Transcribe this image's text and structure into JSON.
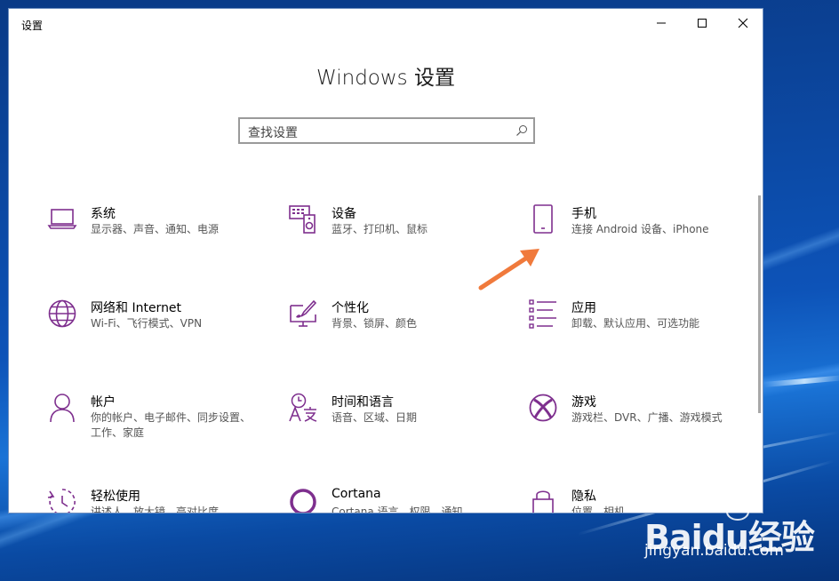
{
  "window": {
    "title": "设置",
    "controls": {
      "minimize": "minimize-icon",
      "maximize": "maximize-icon",
      "close": "close-icon"
    }
  },
  "page": {
    "title": "Windows 设置"
  },
  "search": {
    "placeholder": "查找设置",
    "icon": "search-icon"
  },
  "accent": "#7e2f8e",
  "tiles": [
    {
      "name": "系统",
      "desc": "显示器、声音、通知、电源",
      "icon": "laptop-icon"
    },
    {
      "name": "设备",
      "desc": "蓝牙、打印机、鼠标",
      "icon": "keyboard-speaker-icon"
    },
    {
      "name": "手机",
      "desc": "连接 Android 设备、iPhone",
      "icon": "phone-icon"
    },
    {
      "name": "网络和 Internet",
      "desc": "Wi-Fi、飞行模式、VPN",
      "icon": "globe-icon"
    },
    {
      "name": "个性化",
      "desc": "背景、锁屏、颜色",
      "icon": "paint-monitor-icon"
    },
    {
      "name": "应用",
      "desc": "卸载、默认应用、可选功能",
      "icon": "app-list-icon"
    },
    {
      "name": "帐户",
      "desc": "你的帐户、电子邮件、同步设置、工作、家庭",
      "icon": "person-icon"
    },
    {
      "name": "时间和语言",
      "desc": "语音、区域、日期",
      "icon": "time-language-icon"
    },
    {
      "name": "游戏",
      "desc": "游戏栏、DVR、广播、游戏模式",
      "icon": "xbox-icon"
    },
    {
      "name": "轻松使用",
      "desc": "讲述人、放大镜、高对比度",
      "icon": "ease-of-access-icon"
    },
    {
      "name": "Cortana",
      "desc": "Cortana 语言、权限、通知",
      "icon": "cortana-icon"
    },
    {
      "name": "隐私",
      "desc": "位置、相机",
      "icon": "lock-icon"
    }
  ],
  "watermark": {
    "logo": "Baidu经验",
    "url": "jingyan.baidu.com"
  }
}
